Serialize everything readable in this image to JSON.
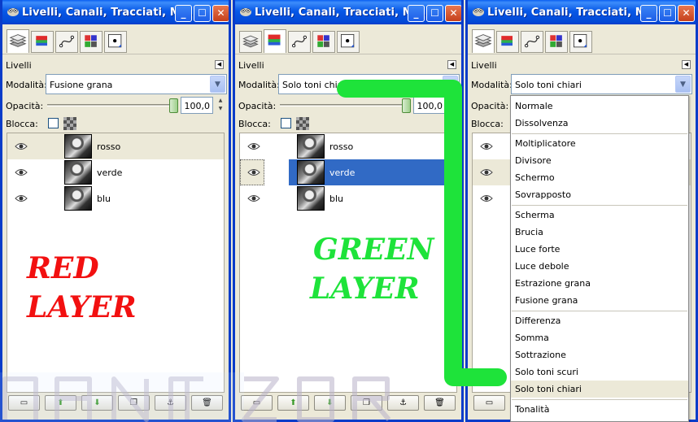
{
  "windows": [
    {
      "title": "Livelli, Canali, Tracciati, M...",
      "panel_label": "Livelli",
      "mode_label": "Modalità:",
      "mode_value": "Fusione grana",
      "opacity_label": "Opacità:",
      "opacity_value": "100,0",
      "lock_label": "Blocca:",
      "layers": [
        {
          "name": "rosso",
          "state": "highlighted"
        },
        {
          "name": "verde",
          "state": "normal"
        },
        {
          "name": "blu",
          "state": "normal"
        }
      ],
      "overlay_text": [
        "RED",
        "LAYER"
      ]
    },
    {
      "title": "Livelli, Canali, Tracciati, M...",
      "panel_label": "Livelli",
      "mode_label": "Modalità:",
      "mode_value": "Solo toni chiari",
      "opacity_label": "Opacità:",
      "opacity_value": "100,0",
      "lock_label": "Blocca:",
      "layers": [
        {
          "name": "rosso",
          "state": "normal"
        },
        {
          "name": "verde",
          "state": "selected"
        },
        {
          "name": "blu",
          "state": "normal"
        }
      ],
      "overlay_text": [
        "GREEN",
        "LAYER"
      ]
    },
    {
      "title": "Livelli, Canali, Tracciati, M...",
      "panel_label": "Livelli",
      "mode_label": "Modalità:",
      "mode_value": "Solo toni chiari",
      "opacity_label": "Opacità:",
      "lock_label": "Blocca:"
    }
  ],
  "mode_menu": {
    "groups": [
      [
        "Normale",
        "Dissolvenza"
      ],
      [
        "Moltiplicatore",
        "Divisore",
        "Schermo",
        "Sovrapposto"
      ],
      [
        "Scherma",
        "Brucia",
        "Luce forte",
        "Luce debole",
        "Estrazione grana",
        "Fusione grana"
      ],
      [
        "Differenza",
        "Somma",
        "Sottrazione",
        "Solo toni scuri",
        "Solo toni chiari"
      ],
      [
        "Tonalità"
      ]
    ],
    "highlighted": "Solo toni chiari"
  },
  "colors": {
    "xp_title_blue": "#0a5ff2",
    "selection_blue": "#316ac5",
    "annotation_red": "#f21010",
    "annotation_green": "#1ee33a",
    "panel_bg": "#ece9d8"
  },
  "icons": {
    "window": "gimp-icon",
    "tabs": [
      "layers-tab-icon",
      "channels-tab-icon",
      "paths-tab-icon",
      "color-palette-tab-icon",
      "brush-tab-icon"
    ],
    "layer_visibility": "eye-icon",
    "bottom_buttons": [
      "new-layer-icon",
      "raise-layer-icon",
      "lower-layer-icon",
      "duplicate-layer-icon",
      "anchor-layer-icon",
      "delete-layer-icon"
    ]
  }
}
